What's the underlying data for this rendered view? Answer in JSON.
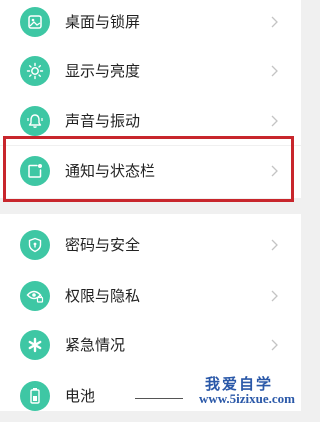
{
  "settings_groups": [
    {
      "items": [
        {
          "label": "桌面与锁屏",
          "icon": "image-icon"
        },
        {
          "label": "显示与亮度",
          "icon": "sun-icon"
        },
        {
          "label": "声音与振动",
          "icon": "bell-icon"
        }
      ]
    },
    {
      "items": [
        {
          "label": "通知与状态栏",
          "icon": "notification-icon"
        }
      ]
    },
    {
      "items": [
        {
          "label": "密码与安全",
          "icon": "shield-icon"
        },
        {
          "label": "权限与隐私",
          "icon": "eye-lock-icon"
        },
        {
          "label": "紧急情况",
          "icon": "asterisk-icon"
        },
        {
          "label": "电池",
          "icon": "battery-icon"
        }
      ]
    }
  ],
  "highlighted_item": "通知与状态栏",
  "colors": {
    "icon_bg": "#3ec7a4",
    "highlight_border": "#c8262c",
    "background": "#f0f0f0",
    "watermark": "#2a58a8"
  },
  "watermark": {
    "title": "我爱自学",
    "url": "www.5izixue.com"
  }
}
